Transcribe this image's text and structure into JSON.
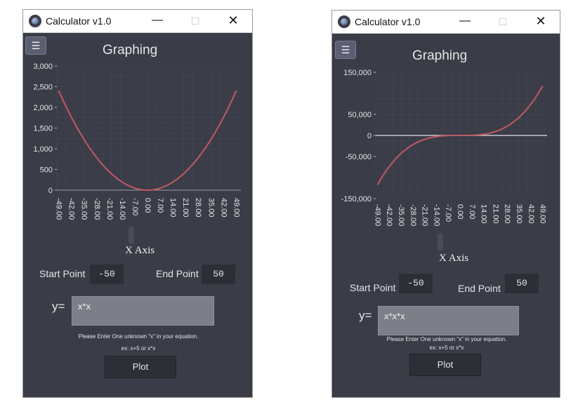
{
  "windows": [
    {
      "title": "Calculator v1.0",
      "controls": {
        "minimize": "—",
        "maximize": "☐",
        "close": "✕"
      },
      "menu_icon": "hamburger-icon",
      "graph_title": "Graphing",
      "y_tick_labels": [
        "3,000",
        "2,500",
        "2,000",
        "1,500",
        "1,000",
        "500",
        "0"
      ],
      "x_tick_labels": [
        "-49.00",
        "-42.00",
        "-35.00",
        "-28.00",
        "-21.00",
        "-14.00",
        "-7.00",
        "0.00",
        "7.00",
        "14.00",
        "21.00",
        "28.00",
        "35.00",
        "42.00",
        "49.00"
      ],
      "x_axis_label": "X Axis",
      "start_label": "Start Point",
      "start_value": "-50",
      "end_label": "End Point",
      "end_value": "50",
      "y_equals": "y=",
      "equation": "x*x",
      "hint_line1": "Please Enter One unknown \"x\" in your equation.",
      "hint_line2": "ex: x+5 or x*x",
      "plot_button": "Plot"
    },
    {
      "title": "Calculator v1.0",
      "controls": {
        "minimize": "—",
        "maximize": "☐",
        "close": "✕"
      },
      "menu_icon": "hamburger-icon",
      "graph_title": "Graphing",
      "y_tick_labels": [
        "150,000",
        "50,000",
        "0",
        "-50,000",
        "-150,000"
      ],
      "x_tick_labels": [
        "-49.00",
        "-42.00",
        "-35.00",
        "-28.00",
        "-21.00",
        "-14.00",
        "-7.00",
        "0.00",
        "7.00",
        "14.00",
        "21.00",
        "28.00",
        "35.00",
        "42.00",
        "49.00"
      ],
      "x_axis_label": "X Axis",
      "start_label": "Start Point",
      "start_value": "-50",
      "end_label": "End Point",
      "end_value": "50",
      "y_equals": "y=",
      "equation": "x*x*x",
      "hint_line1": "Please Enter One unknown \"x\" in your equation.",
      "hint_line2": "ex: x+5 or x*x",
      "plot_button": "Plot"
    }
  ],
  "chart_data": [
    {
      "type": "line",
      "xlim": [
        -50,
        50
      ],
      "ylim": [
        0,
        3000
      ],
      "series": [
        {
          "values_function": "x*x",
          "x_start": -49,
          "x_end": 49,
          "color": "#c05a62"
        }
      ],
      "grid": true
    },
    {
      "type": "line",
      "xlim": [
        -50,
        50
      ],
      "ylim": [
        -150000,
        150000
      ],
      "series": [
        {
          "values_function": "x*x*x",
          "x_start": -49,
          "x_end": 49,
          "color": "#c05a62"
        }
      ],
      "zero_line_color": "#c8c8d0",
      "grid": true
    }
  ]
}
